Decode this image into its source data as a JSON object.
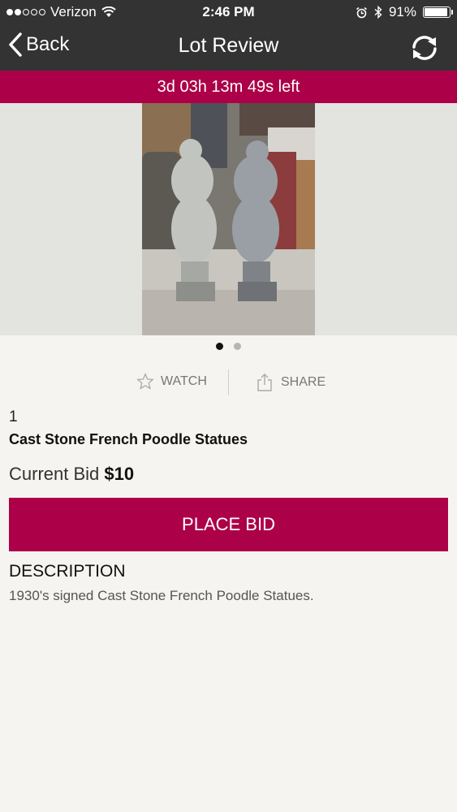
{
  "status_bar": {
    "carrier": "Verizon",
    "time": "2:46 PM",
    "battery_percent": "91%",
    "signal_bars_filled": 2,
    "signal_bars_total": 5,
    "icons": [
      "signal-dots-icon",
      "wifi-icon",
      "alarm-icon",
      "bluetooth-icon",
      "battery-icon"
    ]
  },
  "nav": {
    "back_label": "Back",
    "title": "Lot Review",
    "refresh_icon": "refresh-icon"
  },
  "timer": {
    "text": "3d 03h 13m 49s left"
  },
  "gallery": {
    "image_count": 2,
    "active_index": 0
  },
  "actions": {
    "watch_label": "WATCH",
    "share_label": "SHARE"
  },
  "lot": {
    "number": "1",
    "title": "Cast Stone French Poodle Statues",
    "current_bid_label": "Current Bid",
    "current_bid_value": "$10"
  },
  "bid_button": {
    "label": "PLACE BID"
  },
  "description": {
    "heading": "DESCRIPTION",
    "text": "1930's signed Cast Stone French Poodle Statues."
  },
  "colors": {
    "accent": "#ac0048",
    "bar_background": "#333333",
    "page_background": "#f5f4f1"
  }
}
